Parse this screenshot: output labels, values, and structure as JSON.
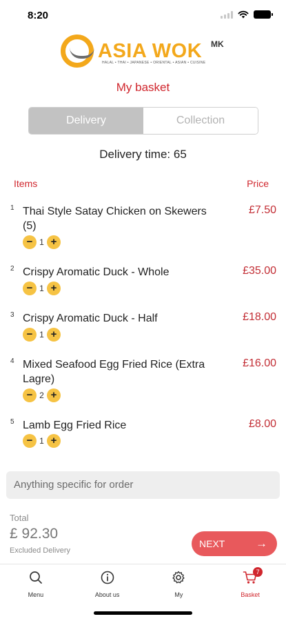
{
  "status_bar": {
    "time": "8:20"
  },
  "logo": {
    "brand": "ASIA WOK",
    "suffix": "MK",
    "tagline": "HALAL • THAI • JAPANESE • ORIENTAL • ASIAN • CUISINE"
  },
  "page": {
    "title": "My basket"
  },
  "order_type": {
    "options": [
      "Delivery",
      "Collection"
    ],
    "selected": "Delivery"
  },
  "delivery_time": "Delivery time: 65",
  "table": {
    "items_header": "Items",
    "price_header": "Price"
  },
  "items": [
    {
      "num": "1",
      "name": "Thai Style Satay Chicken on Skewers (5)",
      "qty": "1",
      "price": "£7.50"
    },
    {
      "num": "2",
      "name": "Crispy Aromatic Duck - Whole",
      "qty": "1",
      "price": "£35.00"
    },
    {
      "num": "3",
      "name": "Crispy Aromatic Duck - Half",
      "qty": "1",
      "price": "£18.00"
    },
    {
      "num": "4",
      "name": "Mixed Seafood Egg Fried Rice (Extra Lagre)",
      "qty": "2",
      "price": "£16.00"
    },
    {
      "num": "5",
      "name": "Lamb Egg Fried Rice",
      "qty": "1",
      "price": "£8.00"
    }
  ],
  "qty_controls": {
    "minus": "−",
    "plus": "+"
  },
  "notes": {
    "placeholder": "Anything specific for order"
  },
  "total": {
    "label": "Total",
    "value": "£ 92.30",
    "note": "Excluded Delivery"
  },
  "next_button": {
    "label": "NEXT",
    "arrow": "→"
  },
  "tabbar": {
    "tabs": [
      {
        "label": "Menu",
        "icon": "search-icon"
      },
      {
        "label": "About us",
        "icon": "info-icon"
      },
      {
        "label": "My",
        "icon": "gear-icon"
      },
      {
        "label": "Basket",
        "icon": "cart-icon",
        "badge": "7",
        "active": true
      }
    ]
  },
  "colors": {
    "accent": "#d0262d",
    "brand": "#f3a81b",
    "qty_button": "#f6c344",
    "next_button": "#e8595c"
  }
}
